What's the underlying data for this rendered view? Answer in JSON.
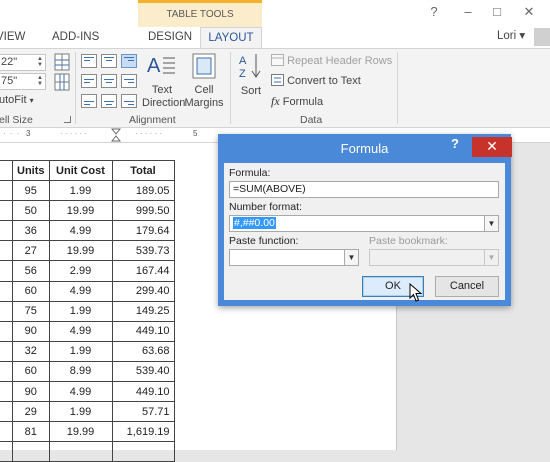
{
  "titlebar": {
    "context_label": "TABLE TOOLS",
    "help_glyph": "?",
    "min_glyph": "–",
    "restore_glyph": "□",
    "close_glyph": "✕",
    "user_name": "Lori",
    "user_caret": "▾"
  },
  "tabs": {
    "view": "VIEW",
    "addins": "ADD-INS",
    "design": "DESIGN",
    "layout": "LAYOUT"
  },
  "ribbon": {
    "cell_size": {
      "height_value": "22\"",
      "width_value": "75\"",
      "autofit_label": "utoFit",
      "group_label": "ell Size"
    },
    "alignment": {
      "text_direction_label_1": "Text",
      "text_direction_label_2": "Direction",
      "cell_margins_label_1": "Cell",
      "cell_margins_label_2": "Margins",
      "group_label": "Alignment"
    },
    "data": {
      "sort_label": "Sort",
      "repeat_header_rows": "Repeat Header Rows",
      "convert_to_text": "Convert to Text",
      "formula": "Formula",
      "group_label": "Data"
    }
  },
  "ruler": {
    "mark_3": "3",
    "mark_5": "5"
  },
  "table": {
    "headers": [
      "Units",
      "Unit Cost",
      "Total"
    ],
    "rows": [
      [
        "95",
        "1.99",
        "189.05"
      ],
      [
        "50",
        "19.99",
        "999.50"
      ],
      [
        "36",
        "4.99",
        "179.64"
      ],
      [
        "27",
        "19.99",
        "539.73"
      ],
      [
        "56",
        "2.99",
        "167.44"
      ],
      [
        "60",
        "4.99",
        "299.40"
      ],
      [
        "75",
        "1.99",
        "149.25"
      ],
      [
        "90",
        "4.99",
        "449.10"
      ],
      [
        "32",
        "1.99",
        "63.68"
      ],
      [
        "60",
        "8.99",
        "539.40"
      ],
      [
        "90",
        "4.99",
        "449.10"
      ],
      [
        "29",
        "1.99",
        "57.71"
      ],
      [
        "81",
        "19.99",
        "1,619.19"
      ],
      [
        "",
        "",
        ""
      ]
    ]
  },
  "dialog": {
    "title": "Formula",
    "help_glyph": "?",
    "close_glyph": "✕",
    "formula_label": "Formula:",
    "formula_value": "=SUM(ABOVE)",
    "number_format_label": "Number format:",
    "number_format_value": "#,##0.00",
    "paste_function_label": "Paste function:",
    "paste_function_value": "",
    "paste_bookmark_label": "Paste bookmark:",
    "paste_bookmark_value": "",
    "ok_label": "OK",
    "cancel_label": "Cancel",
    "combo_arrow_glyph": "▼"
  },
  "colors": {
    "dialog_accent": "#4a89d8",
    "close_red": "#c7332b",
    "context_tab": "#fbeccc",
    "layout_tab_text": "#2b579a",
    "selection": "#3399ff"
  },
  "icons": [
    "help-icon",
    "minimize-icon",
    "restore-icon",
    "close-icon",
    "gridlines-icon",
    "text-direction-icon",
    "cell-margins-icon",
    "sort-icon",
    "repeat-header-rows-icon",
    "convert-to-text-icon",
    "formula-fx-icon",
    "dialog-launcher-icon",
    "mouse-pointer-icon"
  ]
}
